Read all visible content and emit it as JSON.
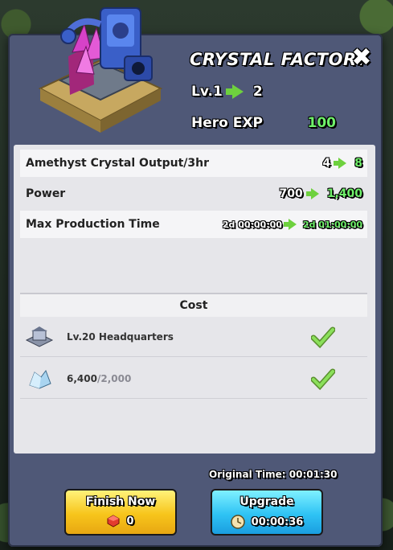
{
  "header": {
    "title": "CRYSTAL FACTORY",
    "level_from": "Lv.1",
    "level_to": "2",
    "hero_exp_label": "Hero EXP",
    "hero_exp_value": "100"
  },
  "stats": [
    {
      "label": "Amethyst Crystal Output/3hr",
      "from": "4",
      "to": "8"
    },
    {
      "label": "Power",
      "from": "700",
      "to": "1,400"
    },
    {
      "label": "Max Production Time",
      "from": "2d 00:00:00",
      "to": "2d 01:00:00"
    }
  ],
  "cost": {
    "title": "Cost",
    "items": [
      {
        "label": "Lv.20 Headquarters",
        "icon": "headquarters-icon",
        "met": true
      },
      {
        "have": "6,400",
        "need": "/2,000",
        "icon": "crystal-icon",
        "met": true
      }
    ]
  },
  "original_time": "Original Time: 00:01:30",
  "buttons": {
    "finish_now": {
      "label": "Finish Now",
      "value": "0",
      "icon": "gem-icon"
    },
    "upgrade": {
      "label": "Upgrade",
      "value": "00:00:36",
      "icon": "clock-icon"
    }
  },
  "colors": {
    "panel": "#4f5877",
    "accent_green": "#6ff06a",
    "finish_button": "#f7c51b",
    "upgrade_button": "#2fc3f4"
  }
}
